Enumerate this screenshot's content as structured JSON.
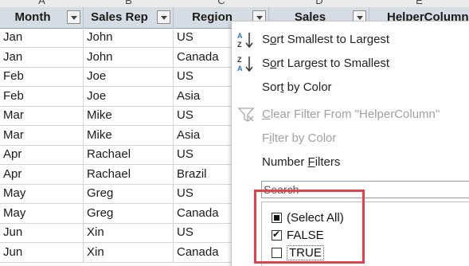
{
  "columns": {
    "letters": [
      "A",
      "B",
      "C",
      "D",
      "E"
    ],
    "headers": [
      "Month",
      "Sales Rep",
      "Region",
      "Sales",
      "HelperColumn"
    ]
  },
  "rows": [
    [
      "Jan",
      "John",
      "US"
    ],
    [
      "Jan",
      "John",
      "Canada"
    ],
    [
      "Feb",
      "Joe",
      "US"
    ],
    [
      "Feb",
      "Joe",
      "Asia"
    ],
    [
      "Mar",
      "Mike",
      "US"
    ],
    [
      "Mar",
      "Mike",
      "Asia"
    ],
    [
      "Apr",
      "Rachael",
      "US"
    ],
    [
      "Apr",
      "Rachael",
      "Brazil"
    ],
    [
      "May",
      "Greg",
      "US"
    ],
    [
      "May",
      "Greg",
      "Canada"
    ],
    [
      "Jun",
      "Xin",
      "US"
    ],
    [
      "Jun",
      "Xin",
      "Canada"
    ]
  ],
  "menu": {
    "sort_asc": {
      "pre": "S",
      "ul": "o",
      "post": "rt Smallest to Largest",
      "icon": "sort-a-to-z-icon"
    },
    "sort_desc": {
      "pre": "S",
      "ul": "o",
      "post": "rt Largest to Smallest",
      "icon": "sort-z-to-a-icon"
    },
    "sort_color": {
      "pre": "Sor",
      "ul": "t",
      "post": " by Color"
    },
    "clear_filter": {
      "pre": "",
      "ul": "C",
      "post": "lear Filter From \"HelperColumn\"",
      "icon": "clear-filter-icon"
    },
    "filter_color": {
      "pre": "F",
      "ul": "i",
      "post": "lter by Color"
    },
    "number_filters": {
      "pre": "Number ",
      "ul": "F",
      "post": "ilters"
    },
    "search_placeholder": "Search",
    "list": [
      {
        "label": "(Select All)",
        "state": "partial"
      },
      {
        "label": "FALSE",
        "state": "checked"
      },
      {
        "label": "TRUE",
        "state": "unchecked"
      }
    ]
  },
  "colors": {
    "header_bg": "#d6dce4",
    "highlight_border": "#e0434b",
    "sort_icon_blue": "#2e75b6"
  }
}
